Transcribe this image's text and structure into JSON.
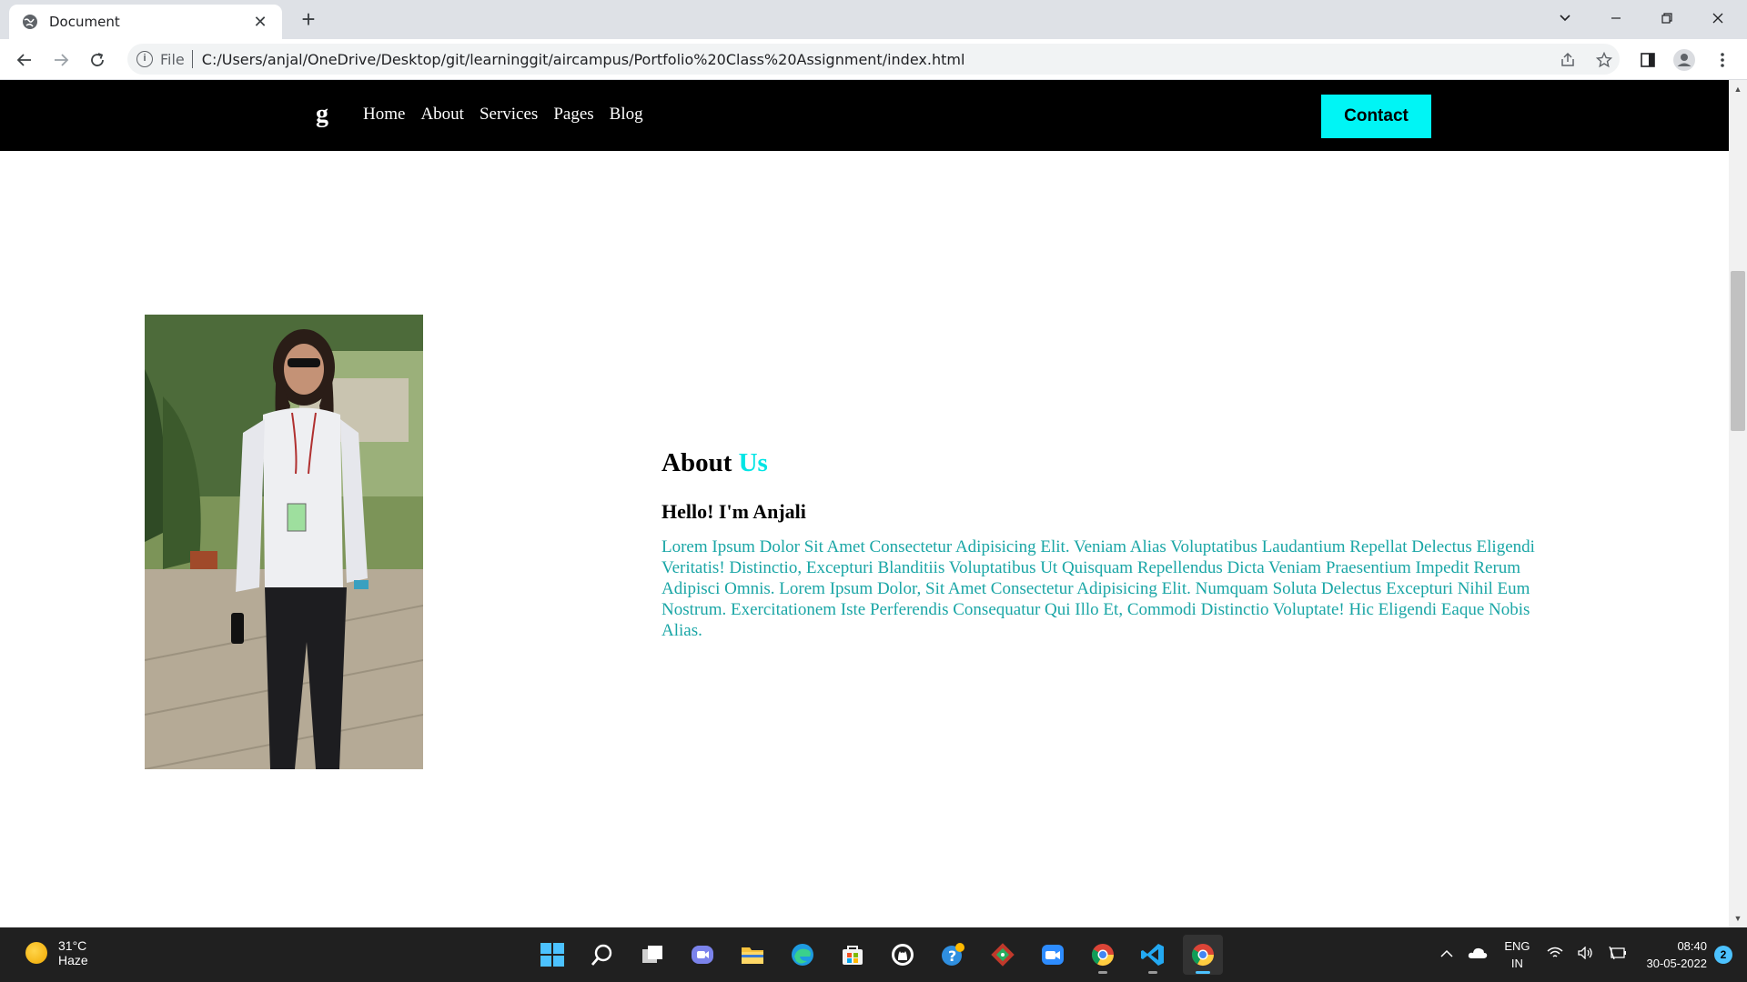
{
  "browser": {
    "tab_title": "Document",
    "tab_close": "✕",
    "new_tab": "+",
    "scheme": "File",
    "url": "C:/Users/anjal/OneDrive/Desktop/git/learninggit/aircampus/Portfolio%20Class%20Assignment/index.html",
    "info_icon": "i"
  },
  "site": {
    "logo": "g",
    "nav": [
      "Home",
      "About",
      "Services",
      "Pages",
      "Blog"
    ],
    "contact_label": "Contact",
    "about": {
      "heading_main": "About",
      "heading_accent": "Us",
      "subheading": "Hello! I'm Anjali",
      "body": "Lorem Ipsum Dolor Sit Amet Consectetur Adipisicing Elit. Veniam Alias Voluptatibus Laudantium Repellat Delectus Eligendi Veritatis! Distinctio, Excepturi Blanditiis Voluptatibus Ut Quisquam Repellendus Dicta Veniam Praesentium Impedit Rerum Adipisci Omnis. Lorem Ipsum Dolor, Sit Amet Consectetur Adipisicing Elit. Numquam Soluta Delectus Excepturi Nihil Eum Nostrum. Exercitationem Iste Perferendis Consequatur Qui Illo Et, Commodi Distinctio Voluptate! Hic Eligendi Eaque Nobis Alias."
    },
    "accent_color": "#00e5e5",
    "contact_color": "#00f5f5"
  },
  "taskbar": {
    "temperature": "31°C",
    "weather": "Haze",
    "language": "ENG",
    "region": "IN",
    "time": "08:40",
    "date": "30-05-2022",
    "notifications": "2"
  }
}
